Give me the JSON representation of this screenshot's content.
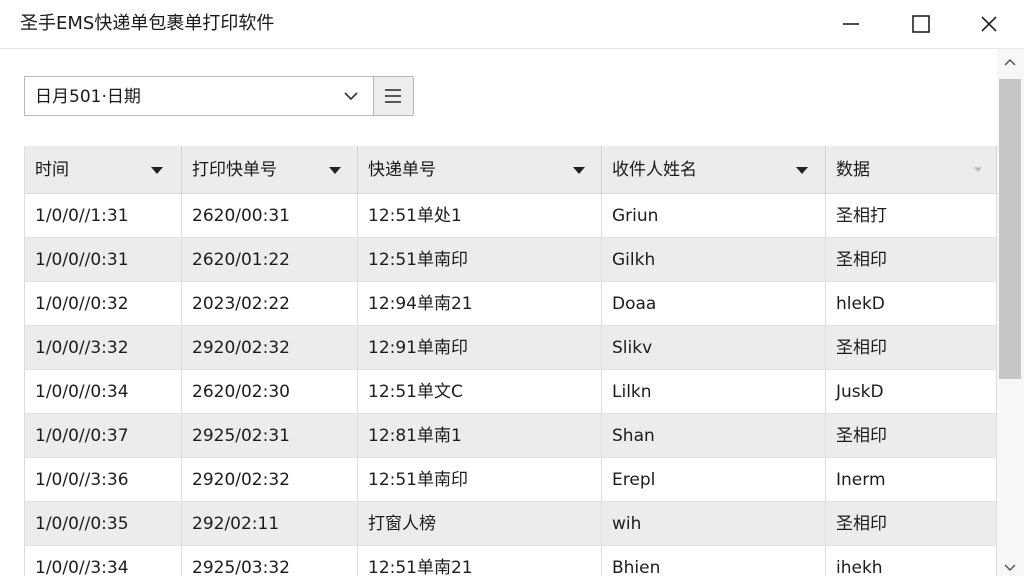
{
  "window": {
    "title": "圣手EMS快递单包裹单打印软件",
    "controls": [
      "minimize-icon",
      "maximize-icon",
      "close-icon"
    ]
  },
  "filter": {
    "selected": "日月501·日期",
    "list_button_icon": "list-icon"
  },
  "table": {
    "columns": [
      "时间",
      "打印快单号",
      "快递单号",
      "收件人姓名",
      "数据"
    ],
    "rows": [
      [
        "1/0/0//1:31",
        "2620/00:31",
        "12:51单处1",
        "Griun",
        "圣相打"
      ],
      [
        "1/0/0//0:31",
        "2620/01:22",
        "12:51单南印",
        "Gilkh",
        "圣相印"
      ],
      [
        "1/0/0//0:32",
        "2023/02:22",
        "12:94单南21",
        "Doaa",
        "hlekD"
      ],
      [
        "1/0/0//3:32",
        "2920/02:32",
        "12:91单南印",
        "Slikv",
        "圣相印"
      ],
      [
        "1/0/0//0:34",
        "2620/02:30",
        "12:51单文C",
        "Lilkn",
        "JuskD"
      ],
      [
        "1/0/0//0:37",
        "2925/02:31",
        "12:81单南1",
        "Shan",
        "圣相印"
      ],
      [
        "1/0/0//3:36",
        "2920/02:32",
        "12:51单南印",
        "Erepl",
        "Inerm"
      ],
      [
        "1/0/0//0:35",
        "292/02:11",
        "打窗人榜",
        "wih",
        "圣相印"
      ],
      [
        "1/0/0//3:34",
        "2925/03:32",
        "12:51单南21",
        "Bhien",
        "ihekh"
      ]
    ]
  },
  "colors": {
    "header_bg": "#ececec",
    "alt_row_bg": "#ececec",
    "border": "#dcdcdc"
  }
}
